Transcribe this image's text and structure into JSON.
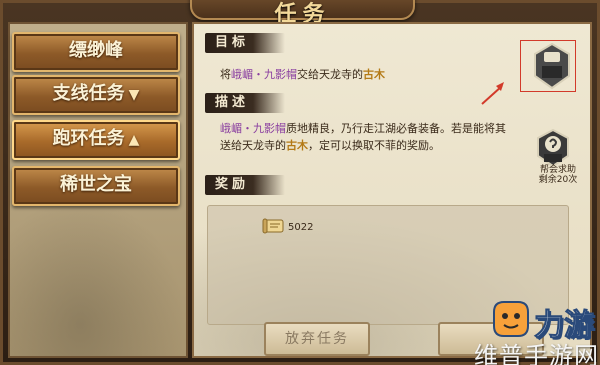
{
  "window": {
    "title": "任务"
  },
  "tabs": [
    {
      "label": "缥缈峰",
      "arrow": ""
    },
    {
      "label": "支线任务",
      "arrow": "▼"
    },
    {
      "label": "跑环任务",
      "arrow": "▲"
    },
    {
      "label": "稀世之宝",
      "arrow": ""
    }
  ],
  "sections": {
    "target_title": "目标",
    "desc_title": "描述",
    "reward_title": "奖励"
  },
  "target": {
    "prefix": "将",
    "item": "峨嵋・九影帽",
    "middle": "交给天龙寺的",
    "npc": "古木"
  },
  "description": {
    "line1_item": "峨嵋・九影帽",
    "line1_rest": "质地精良，乃行走江湖必备装备。若是能将其",
    "line2_prefix": "送给天龙寺的",
    "line2_npc": "古木",
    "line2_rest": "，定可以换取不菲的奖励。"
  },
  "reward": {
    "icon_label": "经验",
    "value": "5022"
  },
  "buttons": {
    "abandon": "放弃任务"
  },
  "side_icons": {
    "task": {
      "label": "任务"
    },
    "help": {
      "label": "帮助",
      "caption_line1": "帮会求助",
      "caption_line2": "剩余20次"
    }
  },
  "watermark": {
    "logo_text": "力游",
    "site_text": "维普手游网"
  },
  "colors": {
    "item_purple": "#8a3fa0",
    "npc_gold": "#b47a16",
    "tab_fill": "#a86a2a",
    "annotation_red": "#d23a2a"
  }
}
